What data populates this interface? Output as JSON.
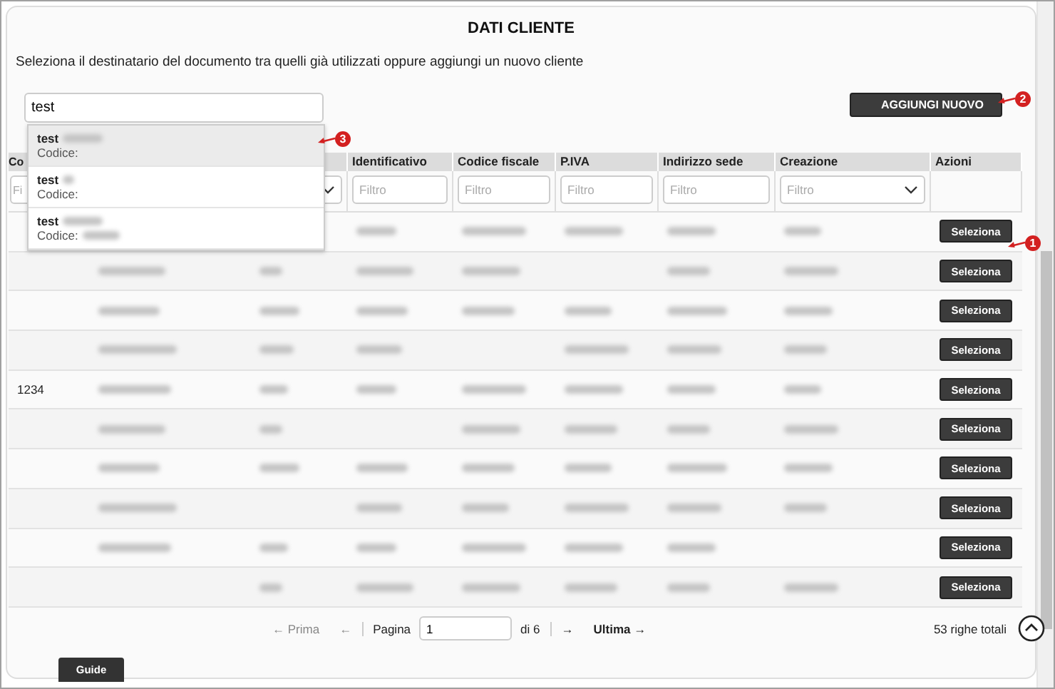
{
  "title": "DATI CLIENTE",
  "description": "Seleziona il destinatario del documento tra quelli già utilizzati oppure aggiungi un nuovo cliente",
  "search": {
    "value": "test"
  },
  "add_button": "AGGIUNGI NUOVO",
  "suggestions": [
    {
      "name": "test",
      "code_label": "Codice:",
      "selected": true
    },
    {
      "name": "test",
      "code_label": "Codice:",
      "selected": false
    },
    {
      "name": "test",
      "code_label": "Codice:",
      "selected": false
    }
  ],
  "table": {
    "columns": [
      {
        "label": "Co",
        "filter": "Fi",
        "kind": "text"
      },
      {
        "kind": "hidden"
      },
      {
        "kind": "select"
      },
      {
        "label": "Identificativo",
        "filter": "Filtro",
        "kind": "text"
      },
      {
        "label": "Codice fiscale",
        "filter": "Filtro",
        "kind": "text"
      },
      {
        "label": "P.IVA",
        "filter": "Filtro",
        "kind": "text"
      },
      {
        "label": "Indirizzo sede",
        "filter": "Filtro",
        "kind": "text"
      },
      {
        "label": "Creazione",
        "filter": "Filtro",
        "kind": "select"
      },
      {
        "label": "Azioni",
        "kind": "none"
      }
    ],
    "rows": [
      {
        "action": "Seleziona"
      },
      {
        "action": "Seleziona"
      },
      {
        "action": "Seleziona"
      },
      {
        "action": "Seleziona"
      },
      {
        "column_1": "1234",
        "action": "Seleziona"
      },
      {
        "action": "Seleziona"
      },
      {
        "action": "Seleziona"
      },
      {
        "action": "Seleziona"
      },
      {
        "action": "Seleziona"
      },
      {
        "action": "Seleziona"
      }
    ]
  },
  "pagination": {
    "first": "← Prima",
    "prev": "←",
    "page_label": "Pagina",
    "page": "1",
    "of": "di 6",
    "next": "→",
    "last": "Ultima →",
    "total": "53 righe totali"
  },
  "guide_tab": "Guide",
  "callouts": [
    {
      "number": "1",
      "kind": "row"
    },
    {
      "number": "2",
      "kind": "add"
    },
    {
      "number": "3",
      "kind": "suggestion"
    }
  ]
}
